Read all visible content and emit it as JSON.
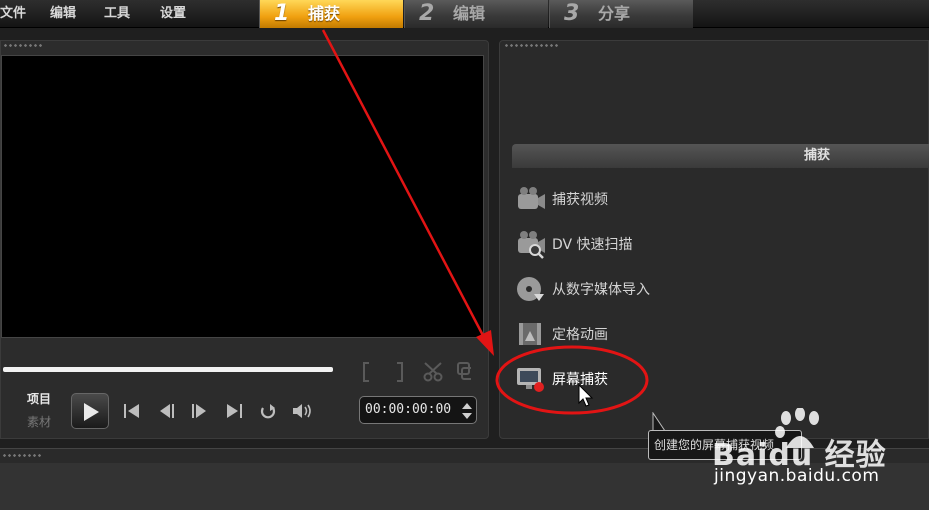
{
  "menu": [
    "文件",
    "编辑",
    "工具",
    "设置"
  ],
  "steps": [
    {
      "num": "1",
      "label": "捕获",
      "active": true
    },
    {
      "num": "2",
      "label": "编辑",
      "active": false
    },
    {
      "num": "3",
      "label": "分享",
      "active": false
    }
  ],
  "player": {
    "mode_project": "项目",
    "mode_clip": "素材",
    "timecode": "00:00:00:00"
  },
  "capture": {
    "header": "捕获",
    "options": [
      {
        "label": "捕获视频",
        "icon": "video-camera-icon"
      },
      {
        "label": "DV 快速扫描",
        "icon": "dv-scan-icon"
      },
      {
        "label": "从数字媒体导入",
        "icon": "disc-import-icon"
      },
      {
        "label": "定格动画",
        "icon": "stop-motion-icon"
      },
      {
        "label": "屏幕捕获",
        "icon": "screen-capture-icon"
      }
    ]
  },
  "tooltip": "创建您的屏幕捕获视频",
  "watermark": {
    "logo": "Baidu 经验",
    "url": "jingyan.baidu.com"
  },
  "colors": {
    "active_tab": "#f0a010",
    "annotation": "#e21414"
  }
}
